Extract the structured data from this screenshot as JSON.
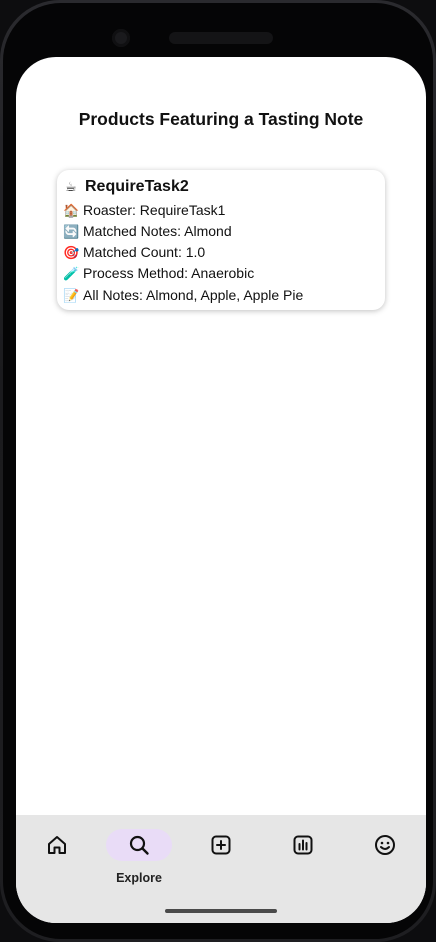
{
  "page": {
    "title": "Products Featuring a Tasting Note"
  },
  "product_card": {
    "name_icon": "☕",
    "name": "RequireTask2",
    "lines": [
      {
        "icon": "🏠",
        "text": "Roaster: RequireTask1"
      },
      {
        "icon": "🔄",
        "text": "Matched Notes: Almond"
      },
      {
        "icon": "🎯",
        "text": "Matched Count: 1.0"
      },
      {
        "icon": "🧪",
        "text": "Process Method: Anaerobic"
      },
      {
        "icon": "📝",
        "text": "All Notes: Almond, Apple, Apple Pie"
      }
    ]
  },
  "bottom_nav": {
    "items": [
      {
        "icon": "home-icon",
        "label": "",
        "active": false
      },
      {
        "icon": "search-icon",
        "label": "Explore",
        "active": true
      },
      {
        "icon": "add-box-icon",
        "label": "",
        "active": false
      },
      {
        "icon": "bar-chart-icon",
        "label": "",
        "active": false
      },
      {
        "icon": "smiley-icon",
        "label": "",
        "active": false
      }
    ]
  },
  "colors": {
    "active_pill": "#e9dcf7",
    "nav_background": "#e6e6e6",
    "screen_background": "#ffffff"
  }
}
